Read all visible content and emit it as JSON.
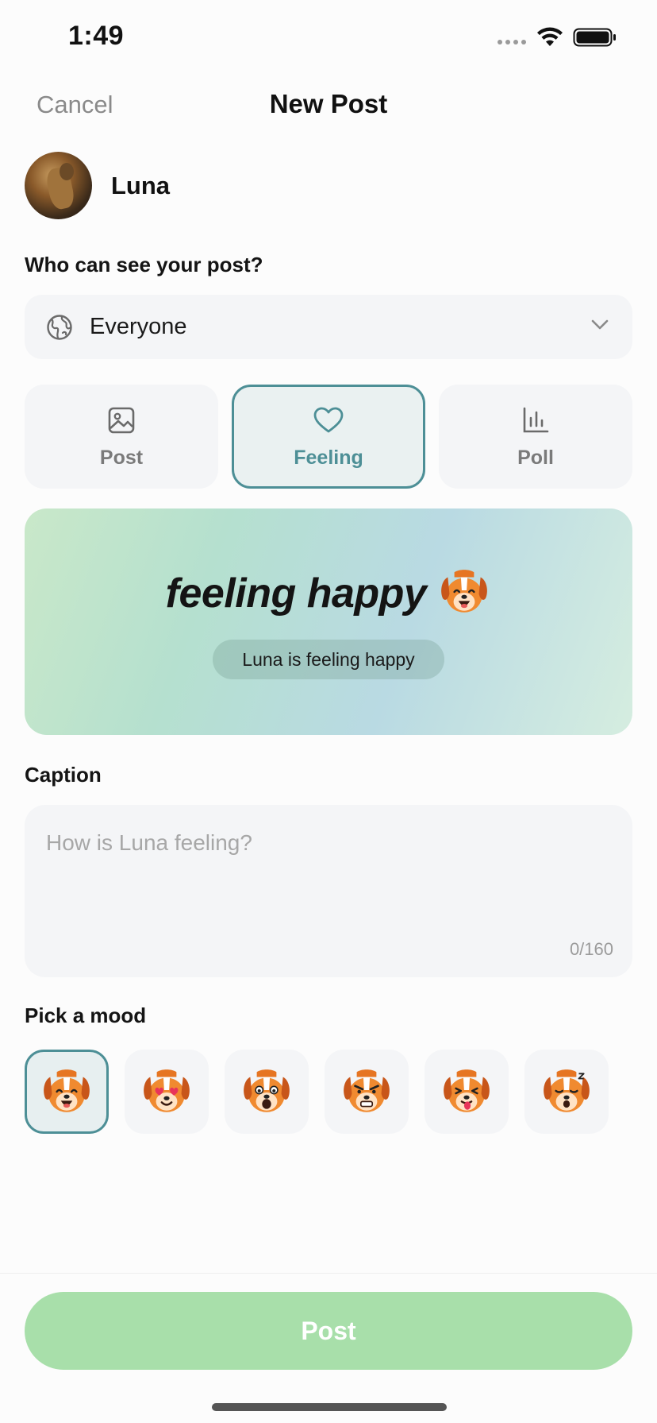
{
  "status_bar": {
    "time": "1:49"
  },
  "nav": {
    "cancel": "Cancel",
    "title": "New Post"
  },
  "profile": {
    "name": "Luna"
  },
  "audience": {
    "label": "Who can see your post?",
    "value": "Everyone",
    "icon": "globe-icon"
  },
  "post_types": [
    {
      "label": "Post",
      "icon": "image-icon",
      "active": false
    },
    {
      "label": "Feeling",
      "icon": "heart-icon",
      "active": true
    },
    {
      "label": "Poll",
      "icon": "bar-chart-icon",
      "active": false
    }
  ],
  "preview": {
    "headline": "feeling happy",
    "subtitle": "Luna is feeling happy"
  },
  "caption": {
    "label": "Caption",
    "placeholder": "How is Luna feeling?",
    "counter": "0/160"
  },
  "moods": {
    "label": "Pick a mood",
    "items": [
      "happy",
      "love",
      "excited",
      "angry",
      "silly",
      "sleepy"
    ],
    "selected": "happy"
  },
  "post_button": {
    "label": "Post"
  },
  "colors": {
    "accent": "#4d8f96",
    "post_button": "#a8dfaa",
    "dog_orange": "#e67522"
  }
}
